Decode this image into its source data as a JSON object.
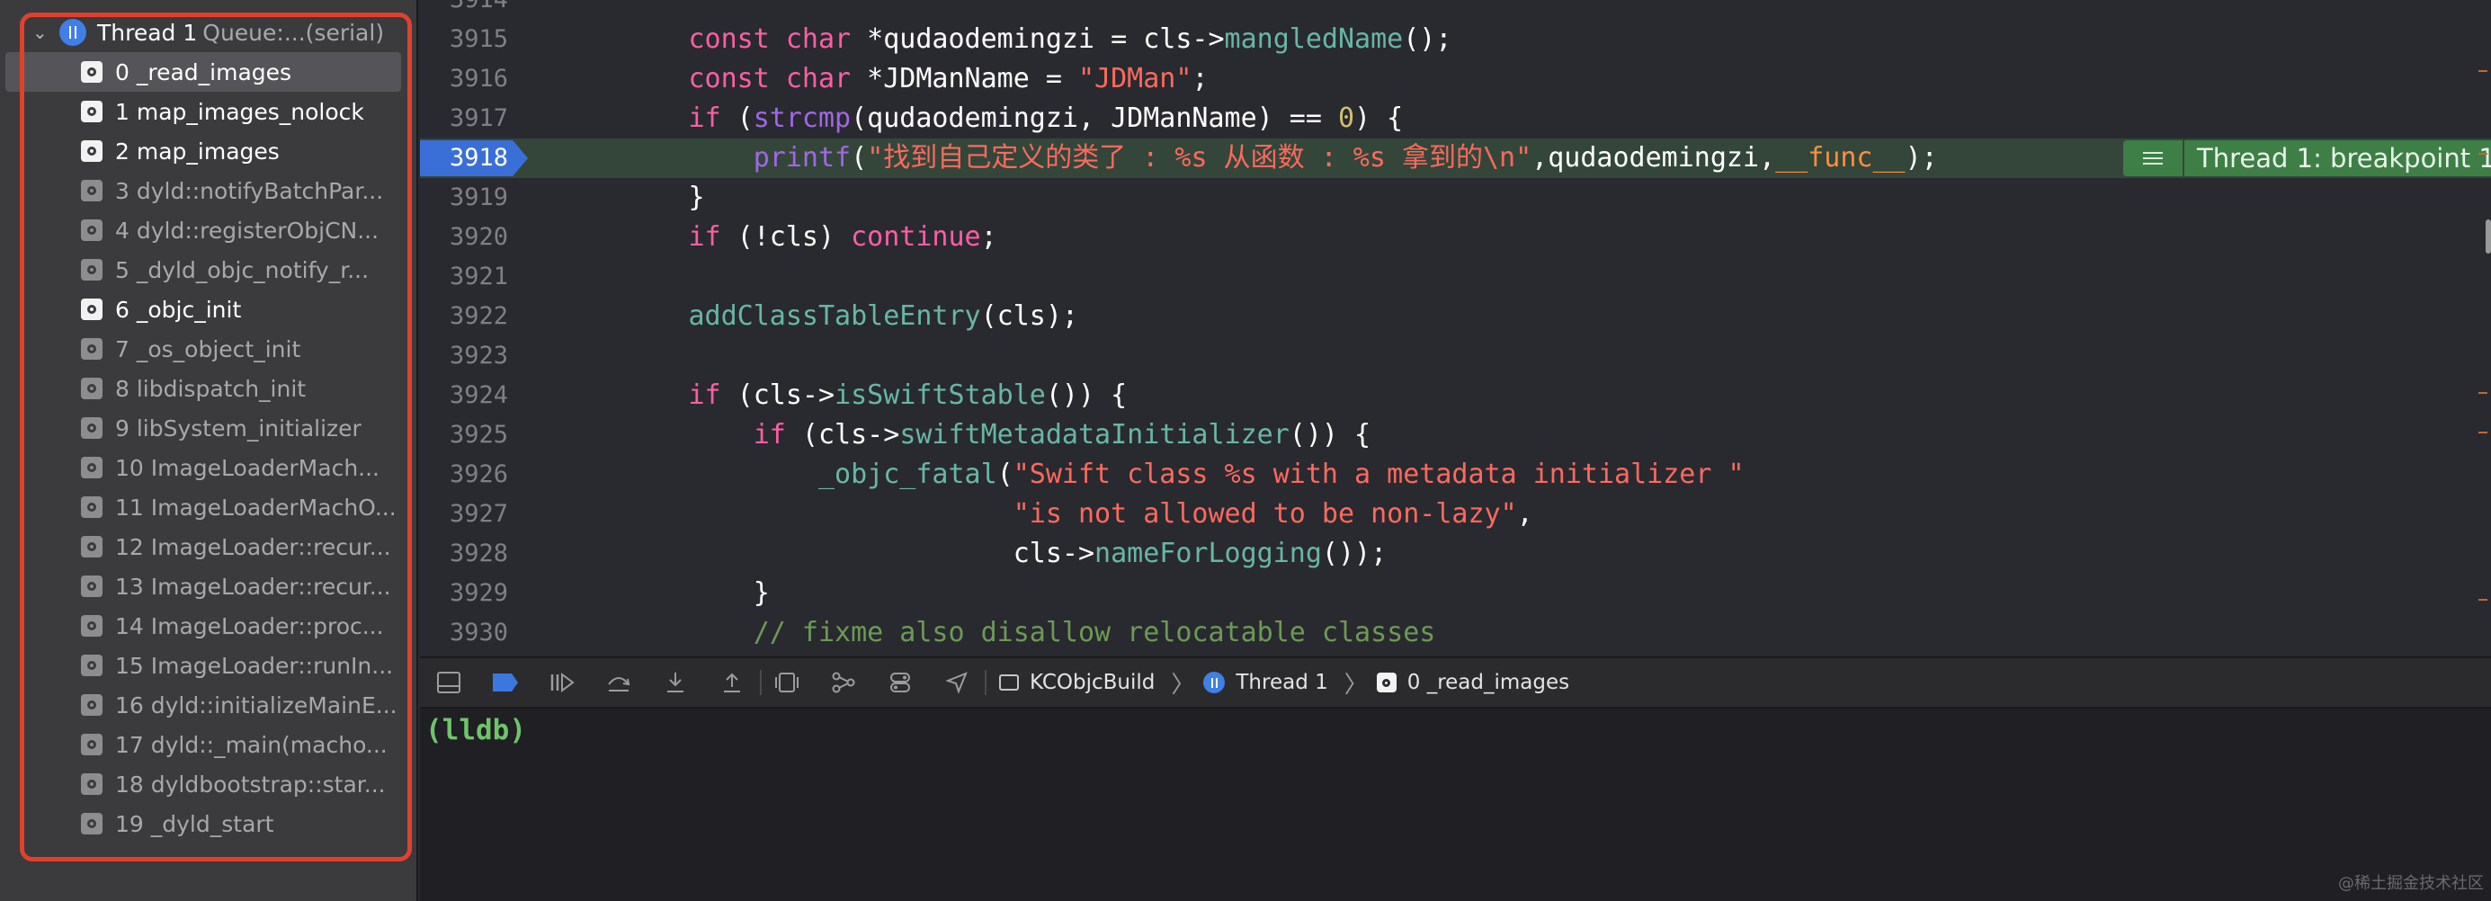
{
  "sidebar": {
    "thread": {
      "name": "Thread 1",
      "queue": "Queue:...(serial)"
    },
    "frames": [
      {
        "label": "0 _read_images",
        "user": true,
        "selected": true
      },
      {
        "label": "1 map_images_nolock",
        "user": true
      },
      {
        "label": "2 map_images",
        "user": true
      },
      {
        "label": "3 dyld::notifyBatchPar...",
        "user": false
      },
      {
        "label": "4 dyld::registerObjCN...",
        "user": false
      },
      {
        "label": "5 _dyld_objc_notify_r...",
        "user": false
      },
      {
        "label": "6 _objc_init",
        "user": true
      },
      {
        "label": "7 _os_object_init",
        "user": false
      },
      {
        "label": "8 libdispatch_init",
        "user": false
      },
      {
        "label": "9 libSystem_initializer",
        "user": false
      },
      {
        "label": "10 ImageLoaderMach...",
        "user": false
      },
      {
        "label": "11 ImageLoaderMachO...",
        "user": false
      },
      {
        "label": "12 ImageLoader::recur...",
        "user": false
      },
      {
        "label": "13 ImageLoader::recur...",
        "user": false
      },
      {
        "label": "14 ImageLoader::proc...",
        "user": false
      },
      {
        "label": "15 ImageLoader::runIn...",
        "user": false
      },
      {
        "label": "16 dyld::initializeMainE...",
        "user": false
      },
      {
        "label": "17 dyld::_main(macho...",
        "user": false
      },
      {
        "label": "18 dyldbootstrap::star...",
        "user": false
      },
      {
        "label": "19 _dyld_start",
        "user": false
      }
    ]
  },
  "editor": {
    "current_line": "3918",
    "breakpoint_label": "Thread 1: breakpoint 1...",
    "lines": [
      {
        "num": "3915",
        "tokens": [
          [
            "",
            "        "
          ],
          [
            "kw",
            "const"
          ],
          [
            "",
            " "
          ],
          [
            "ty",
            "char"
          ],
          [
            "",
            " *qudaodemingzi = cls->"
          ],
          [
            "fn",
            "mangledName"
          ],
          [
            "",
            "();"
          ]
        ]
      },
      {
        "num": "3916",
        "tokens": [
          [
            "",
            "        "
          ],
          [
            "kw",
            "const"
          ],
          [
            "",
            " "
          ],
          [
            "ty",
            "char"
          ],
          [
            "",
            " *JDManName = "
          ],
          [
            "str",
            "\"JDMan\""
          ],
          [
            "",
            ";"
          ]
        ]
      },
      {
        "num": "3917",
        "tokens": [
          [
            "",
            "        "
          ],
          [
            "kw",
            "if"
          ],
          [
            "",
            " ("
          ],
          [
            "fn2",
            "strcmp"
          ],
          [
            "",
            "(qudaodemingzi, JDManName) == "
          ],
          [
            "num",
            "0"
          ],
          [
            "",
            ") {"
          ]
        ]
      },
      {
        "num": "3918",
        "tokens": [
          [
            "",
            "            "
          ],
          [
            "fn2",
            "printf"
          ],
          [
            "",
            "("
          ],
          [
            "str",
            "\"找到自己定义的类了 : %s 从函数 : %s 拿到的\\n\""
          ],
          [
            "",
            ",qudaodemingzi,"
          ],
          [
            "mac",
            "__func__"
          ],
          [
            "",
            ");"
          ]
        ]
      },
      {
        "num": "3919",
        "tokens": [
          [
            "",
            "        }"
          ]
        ]
      },
      {
        "num": "3920",
        "tokens": [
          [
            "",
            "        "
          ],
          [
            "kw",
            "if"
          ],
          [
            "",
            " (!cls) "
          ],
          [
            "kw",
            "continue"
          ],
          [
            "",
            ";"
          ]
        ]
      },
      {
        "num": "3921",
        "tokens": []
      },
      {
        "num": "3922",
        "tokens": [
          [
            "",
            "        "
          ],
          [
            "fn",
            "addClassTableEntry"
          ],
          [
            "",
            "(cls);"
          ]
        ]
      },
      {
        "num": "3923",
        "tokens": []
      },
      {
        "num": "3924",
        "tokens": [
          [
            "",
            "        "
          ],
          [
            "kw",
            "if"
          ],
          [
            "",
            " (cls->"
          ],
          [
            "fn",
            "isSwiftStable"
          ],
          [
            "",
            "()) {"
          ]
        ]
      },
      {
        "num": "3925",
        "tokens": [
          [
            "",
            "            "
          ],
          [
            "kw",
            "if"
          ],
          [
            "",
            " (cls->"
          ],
          [
            "fn",
            "swiftMetadataInitializer"
          ],
          [
            "",
            "()) {"
          ]
        ]
      },
      {
        "num": "3926",
        "tokens": [
          [
            "",
            "                "
          ],
          [
            "fn",
            "_objc_fatal"
          ],
          [
            "",
            "("
          ],
          [
            "str",
            "\"Swift class %s with a metadata initializer \""
          ]
        ]
      },
      {
        "num": "3927",
        "tokens": [
          [
            "",
            "                            "
          ],
          [
            "str",
            "\"is not allowed to be non-lazy\""
          ],
          [
            "",
            ","
          ]
        ]
      },
      {
        "num": "3928",
        "tokens": [
          [
            "",
            "                            cls->"
          ],
          [
            "fn",
            "nameForLogging"
          ],
          [
            "",
            "());"
          ]
        ]
      },
      {
        "num": "3929",
        "tokens": [
          [
            "",
            "            }"
          ]
        ]
      },
      {
        "num": "3930",
        "tokens": [
          [
            "",
            "            "
          ],
          [
            "cm",
            "// fixme also disallow relocatable classes"
          ]
        ]
      }
    ]
  },
  "debugbar": {
    "project": "KCObjcBuild",
    "thread": "Thread 1",
    "frame": "0 _read_images"
  },
  "console": {
    "prompt": "(lldb)"
  },
  "watermark": "@稀土掘金技术社区"
}
